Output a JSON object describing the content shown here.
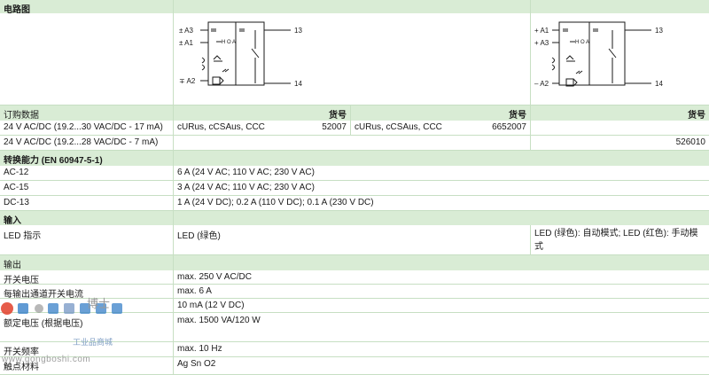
{
  "sections": {
    "circuit": "电路图",
    "order": "订购数据",
    "switching": "转换能力 (EN 60947-5-1)",
    "input": "输入",
    "output": "输出"
  },
  "order": {
    "col_header": "货号",
    "rows": [
      {
        "label": "24 V AC/DC (19.2...30 VAC/DC - 17 mA)",
        "c1_cert": "cURus, cCSAus, CCC",
        "c1_no": "52007",
        "c2_cert": "cURus, cCSAus, CCC",
        "c2_no": "6652007",
        "c3_no": ""
      },
      {
        "label": "24 V AC/DC (19.2...28 VAC/DC - 7 mA)",
        "c1_cert": "",
        "c1_no": "",
        "c2_cert": "",
        "c2_no": "",
        "c3_no": "526010"
      }
    ]
  },
  "switching": [
    {
      "label": "AC-12",
      "value": "6 A (24 V AC; 110 V AC; 230 V AC)"
    },
    {
      "label": "AC-15",
      "value": "3 A (24 V AC; 110 V AC; 230 V AC)"
    },
    {
      "label": "DC-13",
      "value": "1 A (24 V DC); 0.2 A (110 V DC); 0.1 A (230 V DC)"
    }
  ],
  "input": {
    "label": "LED 指示",
    "value": "LED (绿色)",
    "value3": "LED (绿色): 自动模式; LED (红色): 手动模式"
  },
  "output": [
    {
      "label": "开关电压",
      "value": "max. 250 V AC/DC"
    },
    {
      "label": "每输出通道开关电流",
      "value": "max. 6 A"
    },
    {
      "label": "",
      "value": "10 mA (12 V DC)"
    },
    {
      "label": "额定电压 (根据电压)",
      "value": "max. 1500 VA/120 W"
    },
    {
      "label": "开关频率",
      "value": "max. 10 Hz"
    },
    {
      "label": "触点材料",
      "value": "Ag Sn O2"
    }
  ],
  "diagram1": {
    "t_a3": "± A3",
    "t_a1": "± A1",
    "t_a2": "∓ A2",
    "t_13": "13",
    "t_14": "14",
    "hoa": "H O A"
  },
  "diagram2": {
    "t_a1": "+ A1",
    "t_a3": "+ A3",
    "t_a2": "– A2",
    "t_13": "13",
    "t_14": "14",
    "hoa": "H O A"
  },
  "watermark": {
    "brand": "博士",
    "sub": "工业品商城",
    "url": "www.gongboshi.com"
  }
}
